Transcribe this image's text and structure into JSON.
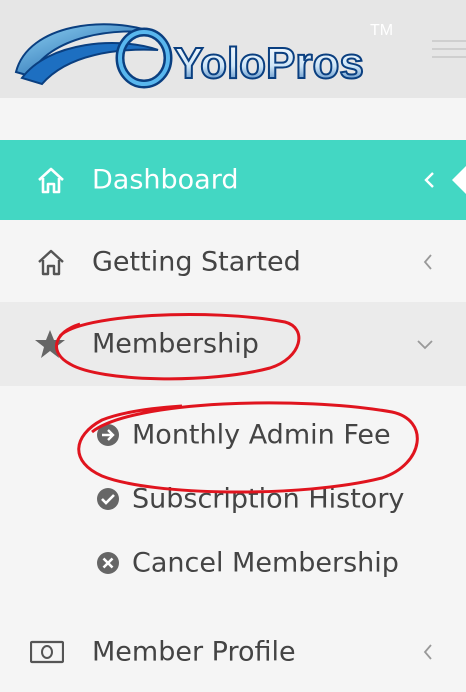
{
  "brand": {
    "name": "YoloPros",
    "tm": "TM"
  },
  "icons": {
    "home": "home-icon",
    "star": "star-icon",
    "circle_arrow_right": "circle-arrow-right-icon",
    "circle_check": "circle-check-icon",
    "circle_x": "circle-x-icon",
    "money": "money-icon",
    "chevron_left": "chevron-left-icon",
    "chevron_down": "chevron-down-icon",
    "hamburger": "hamburger-icon"
  },
  "colors": {
    "active_bg": "#43d7c3",
    "active_text": "#ffffff",
    "text": "#444444",
    "header_bg": "#e6e6e6",
    "annotation_red": "#e0141e"
  },
  "menu": {
    "dashboard": {
      "label": "Dashboard",
      "active": true
    },
    "getting_started": {
      "label": "Getting Started"
    },
    "membership": {
      "label": "Membership",
      "expanded": true,
      "children": [
        {
          "label": "Monthly Admin Fee"
        },
        {
          "label": "Subscription History"
        },
        {
          "label": "Cancel Membership"
        }
      ]
    },
    "member_profile": {
      "label": "Member Profile"
    }
  }
}
